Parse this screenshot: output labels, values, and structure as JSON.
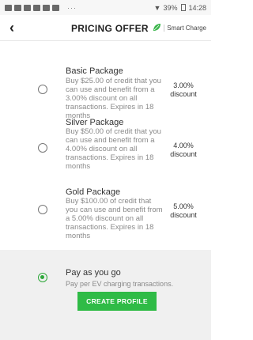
{
  "status_bar": {
    "dots": "···",
    "signal": "▼",
    "battery": "39%",
    "time": "14:28"
  },
  "header": {
    "back_icon": "‹",
    "title": "PRICING OFFER",
    "brand": "Smart Charge"
  },
  "packages": [
    {
      "name": "Basic Package",
      "description": "Buy $25.00 of credit that you can use and benefit from a 3.00% discount on all transactions. Expires in 18 months",
      "discount_value": "3.00%",
      "discount_label": "discount",
      "selected": false
    },
    {
      "name": "Silver Package",
      "description": "Buy $50.00 of credit that you can use and benefit from a 4.00% discount on all transactions. Expires in 18 months",
      "discount_value": "4.00%",
      "discount_label": "discount",
      "selected": false
    },
    {
      "name": "Gold Package",
      "description": "Buy $100.00 of credit that you can use and benefit from a 5.00% discount on all transactions. Expires in 18 months",
      "discount_value": "5.00%",
      "discount_label": "discount",
      "selected": false
    }
  ],
  "pay_as_you_go": {
    "name": "Pay as you go",
    "description": "Pay per EV charging transactions.",
    "selected": true
  },
  "create_profile_label": "CREATE PROFILE",
  "colors": {
    "accent": "#2fbb46",
    "radio_selected": "#2ea83a"
  }
}
